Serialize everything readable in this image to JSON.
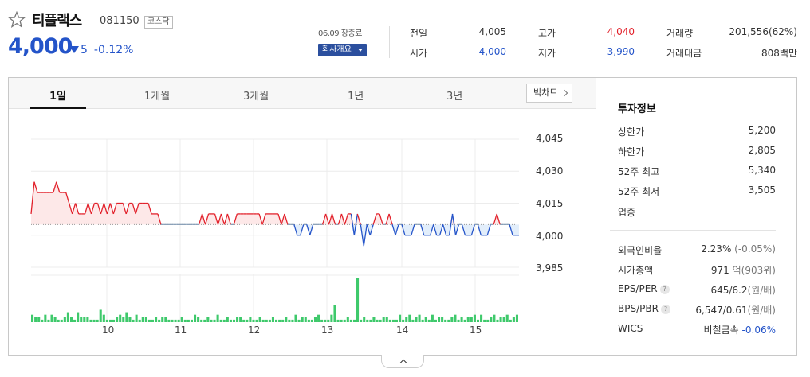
{
  "header": {
    "name": "티플랙스",
    "code": "081150",
    "market": "코스닥",
    "price": "4,000",
    "change": "5",
    "change_pct": "-0.12%",
    "basis_date": "06.09 장종료",
    "company_button": "회사개요"
  },
  "quote": {
    "col1": [
      {
        "label": "전일",
        "value": "4,005"
      },
      {
        "label": "시가",
        "value": "4,000"
      }
    ],
    "col2": [
      {
        "label": "고가",
        "value": "4,040"
      },
      {
        "label": "저가",
        "value": "3,990"
      }
    ],
    "col3": [
      {
        "label": "거래량",
        "value": "201,556(62%)"
      },
      {
        "label": "거래대금",
        "value": "808백만"
      }
    ]
  },
  "tabs": [
    "1일",
    "1개월",
    "3개월",
    "1년",
    "3년"
  ],
  "active_tab": "1일",
  "bigchart_label": "빅차트",
  "colors": {
    "up": "#e2212b",
    "down": "#2454c9",
    "volume": "#3ec96b",
    "up_fill": "#fde8e8",
    "down_fill": "#e2eefb"
  },
  "chart_data": {
    "type": "line",
    "x_ticks": [
      "10",
      "11",
      "12",
      "13",
      "14",
      "15"
    ],
    "y_ticks": [
      "4,045",
      "4,030",
      "4,015",
      "4,000",
      "3,985"
    ],
    "ylim": [
      3985,
      4045
    ],
    "baseline": 4005,
    "price": [
      4010,
      4025,
      4020,
      4020,
      4020,
      4020,
      4020,
      4020,
      4025,
      4020,
      4020,
      4020,
      4015,
      4010,
      4015,
      4010,
      4010,
      4010,
      4015,
      4010,
      4015,
      4015,
      4010,
      4015,
      4010,
      4015,
      4010,
      4015,
      4015,
      4015,
      4010,
      4015,
      4015,
      4010,
      4015,
      4015,
      4015,
      4015,
      4010,
      4010,
      4010,
      4005,
      4005,
      4005,
      4005,
      4005,
      4005,
      4005,
      4005,
      4005,
      4005,
      4005,
      4005,
      4005,
      4010,
      4005,
      4010,
      4010,
      4010,
      4005,
      4010,
      4005,
      4010,
      4005,
      4005,
      4010,
      4010,
      4010,
      4010,
      4010,
      4010,
      4010,
      4010,
      4005,
      4010,
      4010,
      4010,
      4010,
      4010,
      4005,
      4010,
      4005,
      4005,
      4005,
      4000,
      4000,
      4005,
      4005,
      4000,
      4005,
      4005,
      4005,
      4005,
      4010,
      4005,
      4010,
      4005,
      4005,
      4010,
      4005,
      4010,
      4010,
      4000,
      4010,
      4005,
      3995,
      4005,
      4000,
      4005,
      4010,
      4010,
      4005,
      4005,
      4010,
      4005,
      4000,
      4005,
      4005,
      4000,
      4000,
      4000,
      4005,
      4005,
      4005,
      4000,
      4000,
      4000,
      4005,
      4000,
      4000,
      4005,
      4000,
      4000,
      4010,
      4000,
      4005,
      4005,
      4000,
      4000,
      4000,
      4005,
      4005,
      4000,
      4000,
      4000,
      4005,
      4005,
      4010,
      4005,
      4005,
      4005,
      4005,
      4000,
      4000,
      4000
    ],
    "volume": [
      3,
      2,
      2,
      1,
      3,
      1,
      3,
      2,
      1,
      1,
      2,
      4,
      2,
      1,
      4,
      2,
      2,
      2,
      1,
      1,
      1,
      5,
      3,
      1,
      1,
      1,
      2,
      3,
      2,
      4,
      2,
      1,
      3,
      1,
      2,
      2,
      1,
      1,
      2,
      1,
      2,
      2,
      1,
      1,
      1,
      1,
      2,
      1,
      1,
      1,
      3,
      2,
      1,
      1,
      2,
      1,
      1,
      3,
      1,
      1,
      2,
      1,
      1,
      2,
      2,
      1,
      1,
      2,
      1,
      1,
      2,
      1,
      1,
      1,
      2,
      1,
      1,
      1,
      2,
      1,
      1,
      3,
      1,
      2,
      2,
      1,
      1,
      2,
      3,
      1,
      1,
      1,
      3,
      7,
      1,
      1,
      1,
      2,
      1,
      1,
      18,
      1,
      2,
      1,
      1,
      2,
      1,
      1,
      2,
      2,
      1,
      1,
      1,
      3,
      1,
      2,
      3,
      1,
      2,
      3,
      1,
      2,
      1,
      3,
      1,
      2,
      2,
      1,
      1,
      2,
      3,
      1,
      2,
      1,
      2,
      2,
      3,
      1,
      3,
      1,
      1,
      2,
      3,
      1,
      2,
      2,
      3,
      1,
      2,
      3
    ]
  },
  "invest": {
    "title": "투자정보",
    "group1": [
      {
        "label": "상한가",
        "value": "5,200",
        "tone": "up"
      },
      {
        "label": "하한가",
        "value": "2,805",
        "tone": "down"
      },
      {
        "label": "52주 최고",
        "value": "5,340",
        "tone": ""
      },
      {
        "label": "52주 최저",
        "value": "3,505",
        "tone": ""
      },
      {
        "label": "업종",
        "value": "",
        "tone": ""
      }
    ],
    "group2": [
      {
        "label": "외국인비율",
        "value": "2.23%",
        "extra": "(-0.05%)",
        "tone": ""
      },
      {
        "label": "시가총액",
        "value": "971",
        "extra": "억(903위)",
        "tone": ""
      },
      {
        "label": "EPS/PER",
        "value": "645/6.2",
        "extra": "(원/배)",
        "tone": "",
        "help": "?"
      },
      {
        "label": "BPS/PBR",
        "value": "6,547/0.61",
        "extra": "(원/배)",
        "tone": "",
        "help": "?"
      },
      {
        "label": "WICS",
        "value": "비철금속",
        "extra": "-0.06%",
        "tone": "down-extra"
      }
    ]
  }
}
